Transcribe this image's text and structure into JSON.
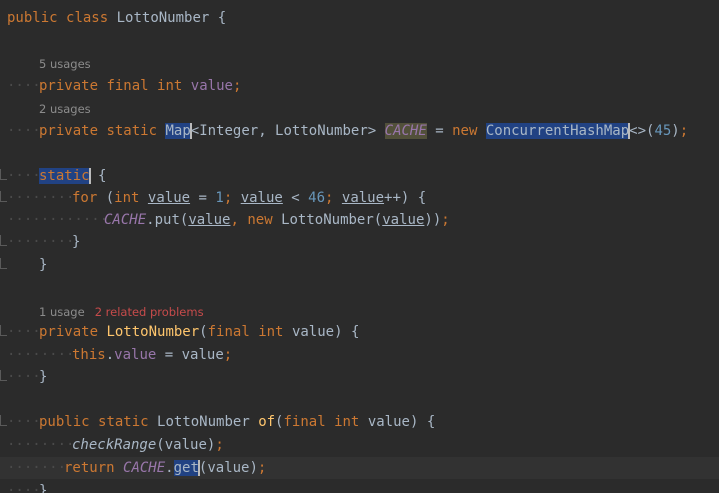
{
  "editor": {
    "colors": {
      "background": "#2b2b2b",
      "keyword": "#cc7832",
      "field": "#9876aa",
      "number": "#6897bb",
      "method_declaration": "#ffc66d",
      "text": "#a9b7c6",
      "hint": "#8c8c8c",
      "problem": "#c74b4b",
      "selection": "#214283"
    },
    "hints": {
      "value_usages": "5 usages",
      "cache_usages": "2 usages",
      "constructor_usages": "1 usage",
      "constructor_problems": "2 related problems"
    },
    "code": {
      "l1": {
        "kw_public": "public",
        "kw_class": "class",
        "class_name": "LottoNumber",
        "brace": "{"
      },
      "l2": {
        "kw_private": "private",
        "kw_final": "final",
        "kw_int": "int",
        "field": "value",
        "semi": ";"
      },
      "l3": {
        "kw_private": "private",
        "kw_static": "static",
        "type_map": "Map",
        "generics": "<Integer, LottoNumber>",
        "field": "CACHE",
        "eq": "=",
        "kw_new": "new",
        "type_chm": "ConcurrentHashMap",
        "diamond": "<>",
        "paren_open": "(",
        "num": "45",
        "paren_close": ")",
        "semi": ";"
      },
      "l4": {
        "kw_static": "static",
        "brace": "{"
      },
      "l5": {
        "kw_for": "for",
        "paren_open": "(",
        "kw_int": "int",
        "var1": "value",
        "eq": "=",
        "num1": "1",
        "semi1": ";",
        "var2": "value",
        "lt": "<",
        "num2": "46",
        "semi2": ";",
        "var3": "value",
        "inc": "++",
        "close": ")",
        "brace": "{"
      },
      "l6": {
        "field": "CACHE",
        "dot_put": ".put(",
        "arg1": "value",
        "comma": ",",
        "kw_new": "new",
        "ctor": "LottoNumber(",
        "arg2": "value",
        "close": "))",
        "semi": ";"
      },
      "l7": {
        "brace": "}"
      },
      "l8": {
        "brace": "}"
      },
      "l9": {
        "kw_private": "private",
        "name": "LottoNumber",
        "paren_open": "(",
        "kw_final": "final",
        "kw_int": "int",
        "param": "value",
        "close": ")",
        "brace": "{"
      },
      "l10": {
        "kw_this": "this",
        "dot": ".",
        "field": "value",
        "eq": "=",
        "val": "value",
        "semi": ";"
      },
      "l11": {
        "brace": "}"
      },
      "l12": {
        "kw_public": "public",
        "kw_static": "static",
        "type": "LottoNumber",
        "name": "of",
        "paren_open": "(",
        "kw_final": "final",
        "kw_int": "int",
        "param": "value",
        "close": ")",
        "brace": "{"
      },
      "l13": {
        "call": "checkRange",
        "args": "(value)",
        "semi": ";"
      },
      "l14": {
        "kw_return": "return",
        "field": "CACHE",
        "dot": ".",
        "method": "get",
        "args": "(value)",
        "semi": ";"
      },
      "l15": {
        "brace": "}"
      }
    }
  }
}
